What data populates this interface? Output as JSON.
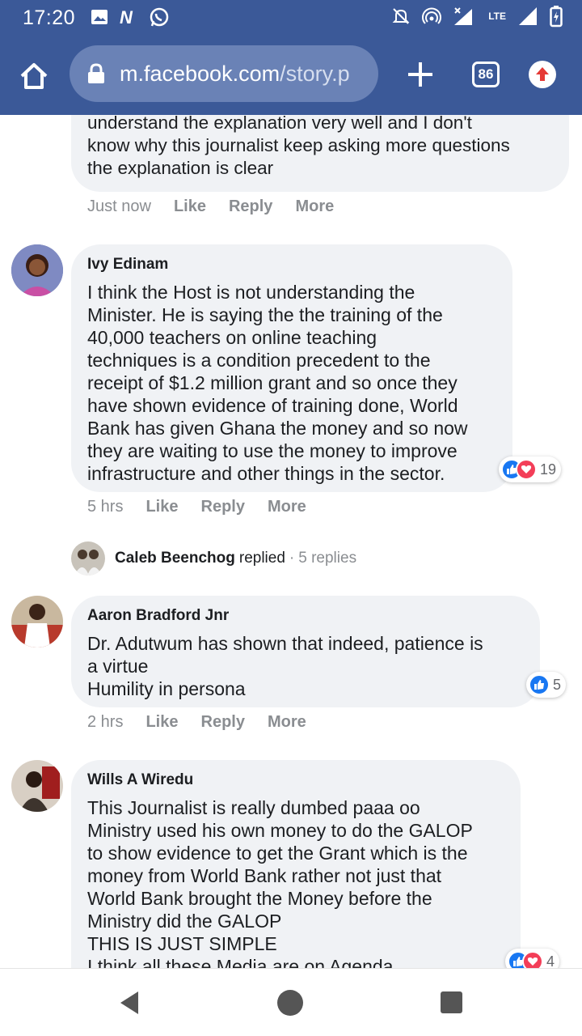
{
  "status_bar": {
    "time": "17:20",
    "network": "LTE",
    "left_icons": [
      "image-icon",
      "n-app-icon",
      "whatsapp-icon"
    ],
    "right_icons": [
      "mute-bell-icon",
      "hotspot-icon",
      "signal-x-icon",
      "lte-icon",
      "signal-icon",
      "battery-icon"
    ]
  },
  "browser": {
    "url_domain": "m.facebook.com",
    "url_path": "/story.p",
    "tab_count": "86"
  },
  "comments": [
    {
      "author": "",
      "text": "understand the explanation very well and I don't\nknow why this journalist keep asking more questions\nthe explanation is clear",
      "time": "Just now",
      "reactions": ""
    },
    {
      "author": "Ivy Edinam",
      "text": "I think the Host is not understanding the\nMinister. He is saying the the training of the\n40,000 teachers on online teaching\ntechniques is a condition precedent to the\nreceipt of $1.2 million grant and so once they\nhave shown evidence of training done, World\nBank has given Ghana the money and so now\nthey are waiting to use the money to improve\ninfrastructure and other things in the sector.",
      "time": "5 hrs",
      "reactions": "19"
    },
    {
      "author": "Aaron Bradford Jnr",
      "text": "Dr. Adutwum has shown that indeed, patience is\na virtue\nHumility in persona",
      "time": "2 hrs",
      "reactions": "5"
    },
    {
      "author": "Wills A Wiredu",
      "text": "This Journalist is really dumbed paaa oo\nMinistry used his own money to do the GALOP\nto show evidence to get the Grant which is the\nmoney from World Bank rather not just that\nWorld Bank brought the Money before the\nMinistry did the GALOP\nTHIS IS JUST SIMPLE\nI think all these Media are on Agenda",
      "time": "",
      "reactions": "4"
    }
  ],
  "actions": {
    "like": "Like",
    "reply": "Reply",
    "more": "More"
  },
  "reply_summary": {
    "name": "Caleb Beenchog",
    "verb": "replied",
    "separator": "·",
    "count": "5 replies"
  },
  "colors": {
    "facebook_blue": "#3b5998",
    "bubble_gray": "#f0f2f5",
    "like_blue": "#1877f2",
    "love_red": "#f33e58",
    "menu_arrow_red": "#e53935"
  }
}
